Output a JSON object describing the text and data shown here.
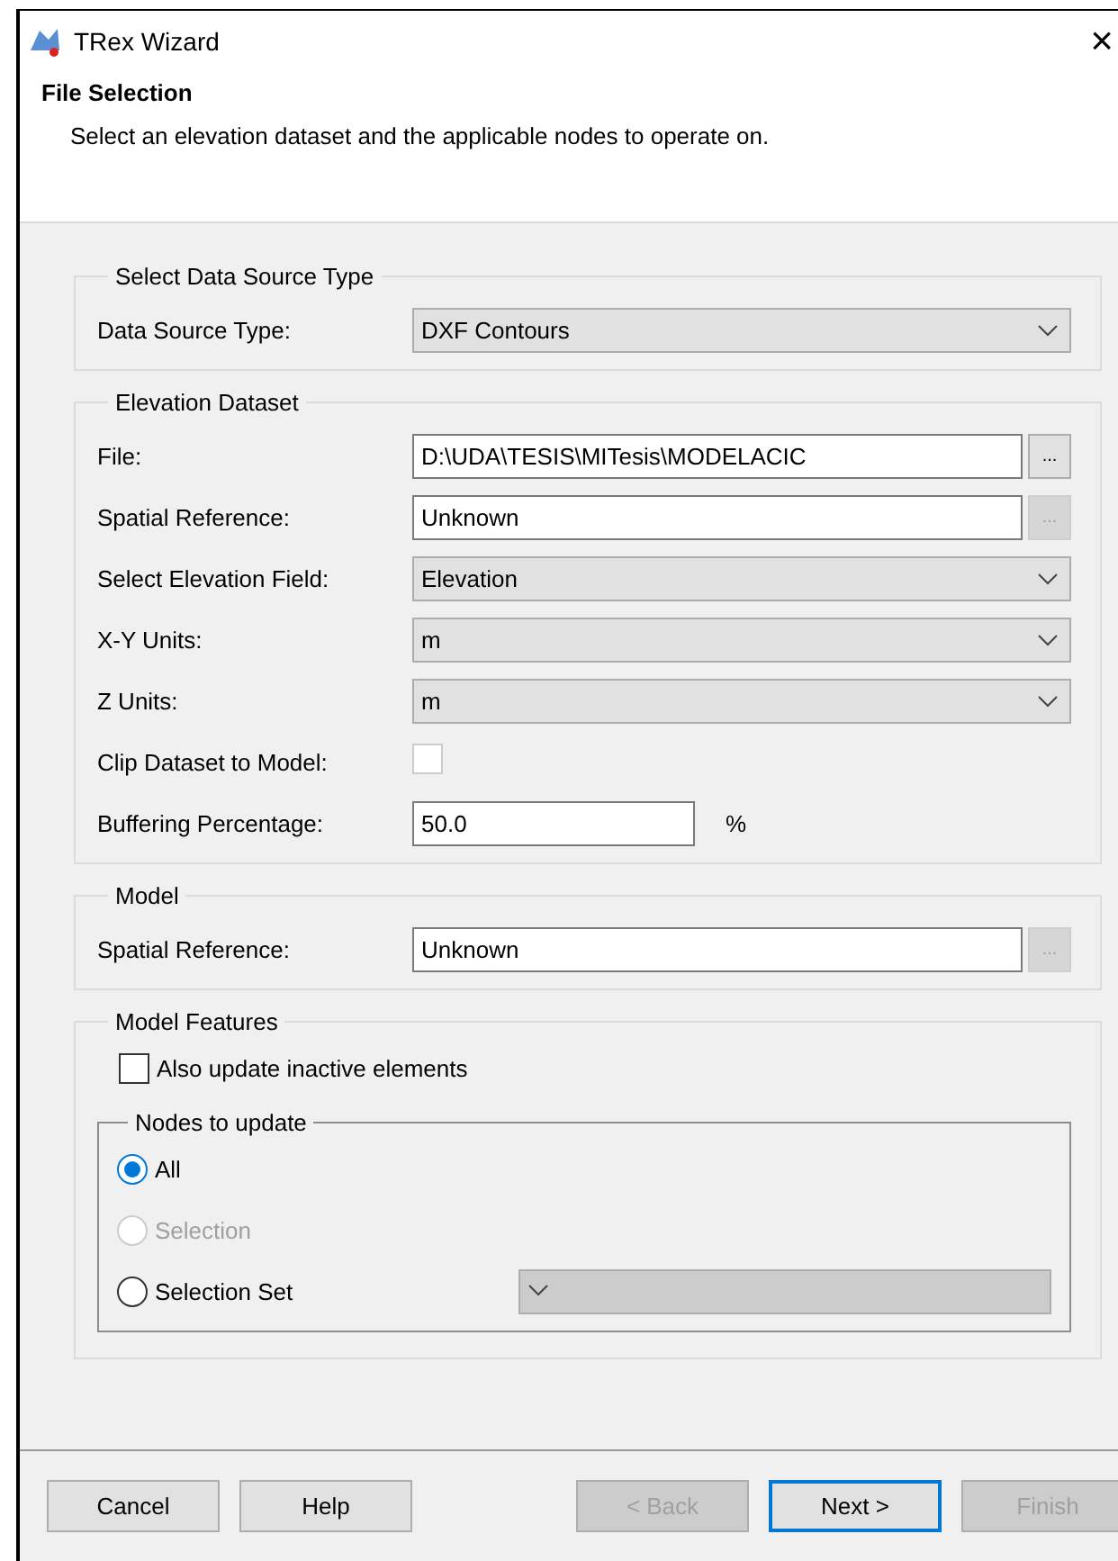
{
  "window": {
    "title": "TRex Wizard",
    "close": "×"
  },
  "header": {
    "title": "File Selection",
    "subtitle": "Select an elevation dataset and the applicable nodes to operate on."
  },
  "groups": [
    {
      "title": "Select Data Source Type",
      "rows": [
        {
          "kind": "combo",
          "label": "Data Source Type:",
          "value": "DXF Contours"
        }
      ]
    },
    {
      "title": "Elevation Dataset",
      "rows": [
        {
          "kind": "browse",
          "label": "File:",
          "value": "D:\\UDA\\TESIS\\MITesis\\MODELACIC",
          "button": "...",
          "disabled": false
        },
        {
          "kind": "browse",
          "label": "Spatial Reference:",
          "value": "Unknown",
          "button": "...",
          "disabled": true
        },
        {
          "kind": "combo",
          "label": "Select Elevation Field:",
          "value": "Elevation"
        },
        {
          "kind": "combo",
          "label": "X-Y Units:",
          "value": "m"
        },
        {
          "kind": "combo",
          "label": "Z Units:",
          "value": "m"
        },
        {
          "kind": "check",
          "label": "Clip Dataset to Model:",
          "checked": false
        },
        {
          "kind": "unit",
          "label": "Buffering Percentage:",
          "value": "50.0",
          "unit": "%"
        }
      ]
    },
    {
      "title": "Model",
      "rows": [
        {
          "kind": "browse",
          "label": "Spatial Reference:",
          "value": "Unknown",
          "button": "...",
          "disabled": true
        }
      ]
    }
  ],
  "features": {
    "title": "Model Features",
    "checkbox": {
      "label": "Also update inactive elements",
      "checked": false
    },
    "nodes": {
      "title": "Nodes to update",
      "options": [
        {
          "kind": "radio",
          "label": "All",
          "selected": true,
          "disabled": false
        },
        {
          "kind": "radio",
          "label": "Selection",
          "selected": false,
          "disabled": true
        },
        {
          "kind": "radio_dropdown",
          "label": "Selection Set",
          "selected": false,
          "disabled": false
        }
      ]
    }
  },
  "buttons_left": [
    {
      "label": "Cancel",
      "disabled": false,
      "default": false
    },
    {
      "label": "Help",
      "disabled": false,
      "default": false
    }
  ],
  "buttons_right": [
    {
      "label": "< Back",
      "disabled": true,
      "default": false
    },
    {
      "label": "Next >",
      "disabled": false,
      "default": true
    },
    {
      "label": "Finish",
      "disabled": true,
      "default": false
    }
  ]
}
